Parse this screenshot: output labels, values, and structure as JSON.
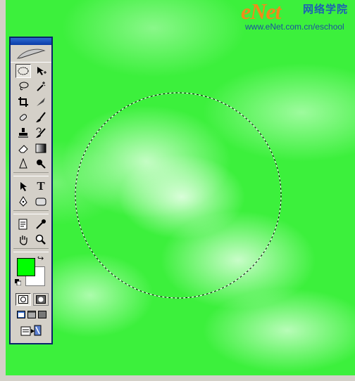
{
  "watermark": {
    "brand": "eNet",
    "chinese": "网络学院",
    "url": "www.eNet.com.cn/eschool"
  },
  "toolbox": {
    "tools": [
      {
        "name": "elliptical-marquee-tool",
        "icon": "ellipse-marquee-icon",
        "active": true
      },
      {
        "name": "move-tool",
        "icon": "move-arrow-icon"
      },
      {
        "name": "lasso-tool",
        "icon": "lasso-icon"
      },
      {
        "name": "magic-wand-tool",
        "icon": "magic-wand-icon"
      },
      {
        "name": "crop-tool",
        "icon": "crop-icon"
      },
      {
        "name": "slice-tool",
        "icon": "slice-knife-icon"
      },
      {
        "name": "healing-brush-tool",
        "icon": "bandage-icon"
      },
      {
        "name": "brush-tool",
        "icon": "brush-icon"
      },
      {
        "name": "clone-stamp-tool",
        "icon": "stamp-icon"
      },
      {
        "name": "history-brush-tool",
        "icon": "history-brush-icon"
      },
      {
        "name": "eraser-tool",
        "icon": "eraser-icon"
      },
      {
        "name": "gradient-tool",
        "icon": "gradient-icon"
      },
      {
        "name": "blur-tool",
        "icon": "blur-drop-icon"
      },
      {
        "name": "dodge-tool",
        "icon": "dodge-icon"
      },
      {
        "name": "path-selection-tool",
        "icon": "selection-arrow-icon"
      },
      {
        "name": "type-tool",
        "icon": "type-icon",
        "glyph": "T"
      },
      {
        "name": "pen-tool",
        "icon": "pen-icon"
      },
      {
        "name": "shape-tool",
        "icon": "rounded-rect-icon"
      },
      {
        "name": "notes-tool",
        "icon": "notes-icon"
      },
      {
        "name": "eyedropper-tool",
        "icon": "eyedropper-icon"
      },
      {
        "name": "hand-tool",
        "icon": "hand-icon"
      },
      {
        "name": "zoom-tool",
        "icon": "magnifier-icon"
      }
    ],
    "foreground_color": "#00ff00",
    "background_color": "#ffffff"
  },
  "canvas": {
    "base_color": "#3cf03c"
  }
}
